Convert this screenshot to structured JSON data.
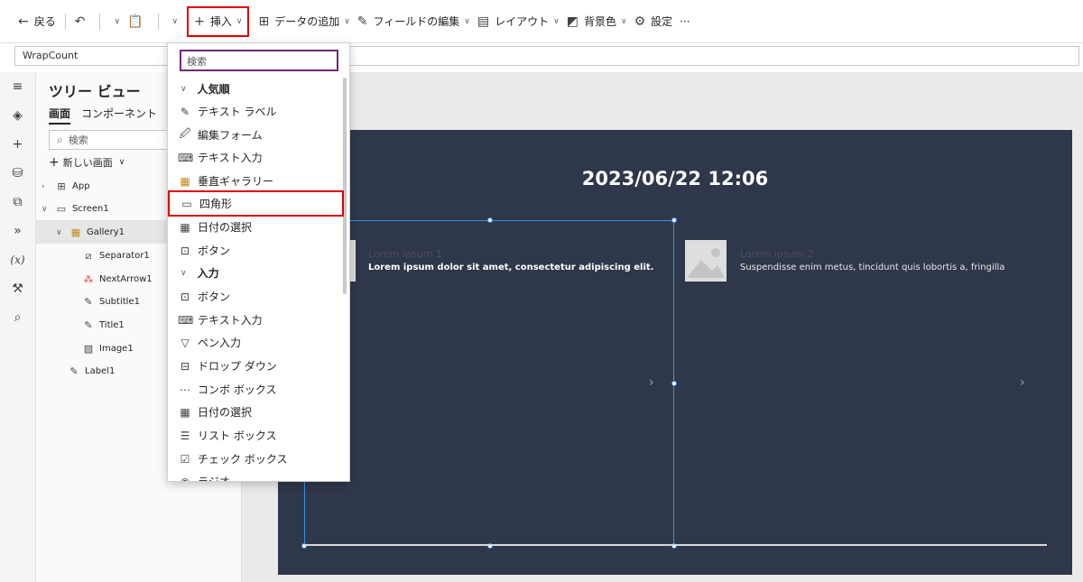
{
  "toolbar": {
    "back": "戻る",
    "insert": "挿入",
    "add_data": "データの追加",
    "edit_fields": "フィールドの編集",
    "layout": "レイアウト",
    "background": "背景色",
    "settings": "設定",
    "more": "···"
  },
  "formula": {
    "property": "WrapCount"
  },
  "tree": {
    "title": "ツリー ビュー",
    "tab_screens": "画面",
    "tab_components": "コンポーネント",
    "search_placeholder": "検索",
    "new_screen": "新しい画面",
    "nodes": [
      "App",
      "Screen1",
      "Gallery1",
      "Separator1",
      "NextArrow1",
      "Subtitle1",
      "Title1",
      "Image1",
      "Label1"
    ]
  },
  "canvas": {
    "datetime": "2023/06/22 12:06",
    "items": [
      {
        "title": "Lorem ipsum 1",
        "subtitle": "Lorem ipsum dolor sit amet, consectetur adipiscing elit."
      },
      {
        "title": "Lorem ipsum 2",
        "subtitle": "Suspendisse enim metus, tincidunt quis lobortis a, fringilla"
      }
    ]
  },
  "insert_menu": {
    "search_placeholder": "検索",
    "popular_header": "人気順",
    "popular": [
      "テキスト ラベル",
      "編集フォーム",
      "テキスト入力",
      "垂直ギャラリー",
      "四角形",
      "日付の選択",
      "ボタン"
    ],
    "input_header": "入力",
    "input": [
      "ボタン",
      "テキスト入力",
      "ペン入力",
      "ドロップ ダウン",
      "コンボ ボックス",
      "日付の選択",
      "リスト ボックス",
      "チェック ボックス",
      "ラジオ"
    ]
  }
}
